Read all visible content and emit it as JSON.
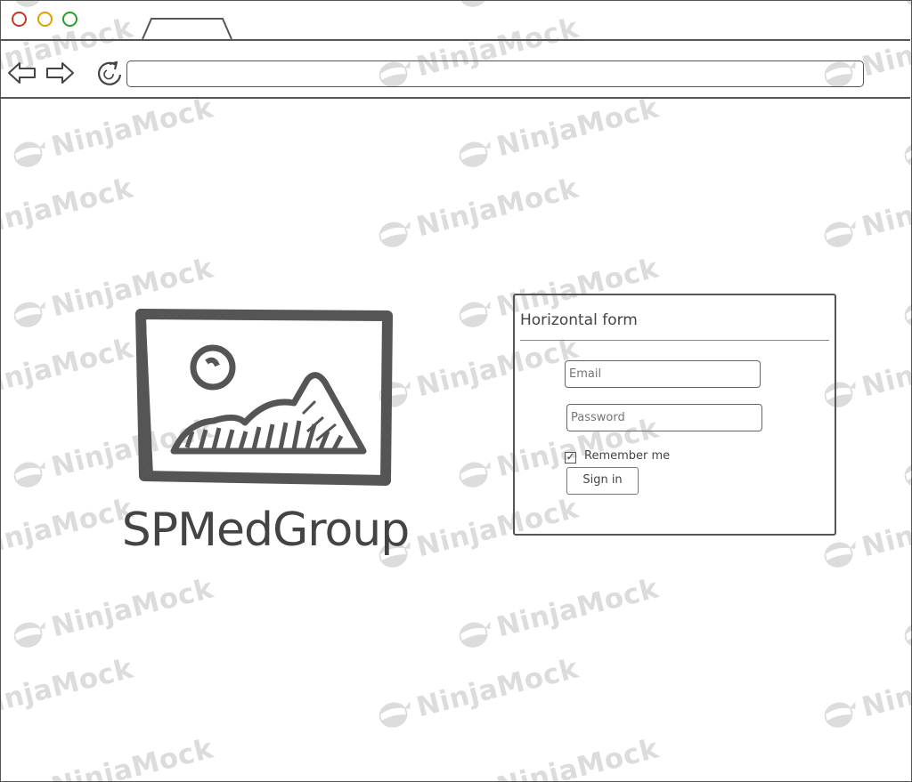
{
  "watermark": {
    "text": "NinjaMock",
    "icon": "ninja-face-icon"
  },
  "browser": {
    "window_controls": [
      "close",
      "minimize",
      "maximize"
    ],
    "nav": {
      "back_icon": "arrow-left-icon",
      "forward_icon": "arrow-right-icon",
      "reload_icon": "reload-icon"
    },
    "url": ""
  },
  "logo": {
    "image_icon": "image-placeholder-icon",
    "name": "SPMedGroup"
  },
  "form": {
    "title": "Horizontal form",
    "email_placeholder": "Email",
    "password_placeholder": "Password",
    "remember_label": "Remember me",
    "remember_checked": true,
    "signin_label": "Sign in"
  }
}
